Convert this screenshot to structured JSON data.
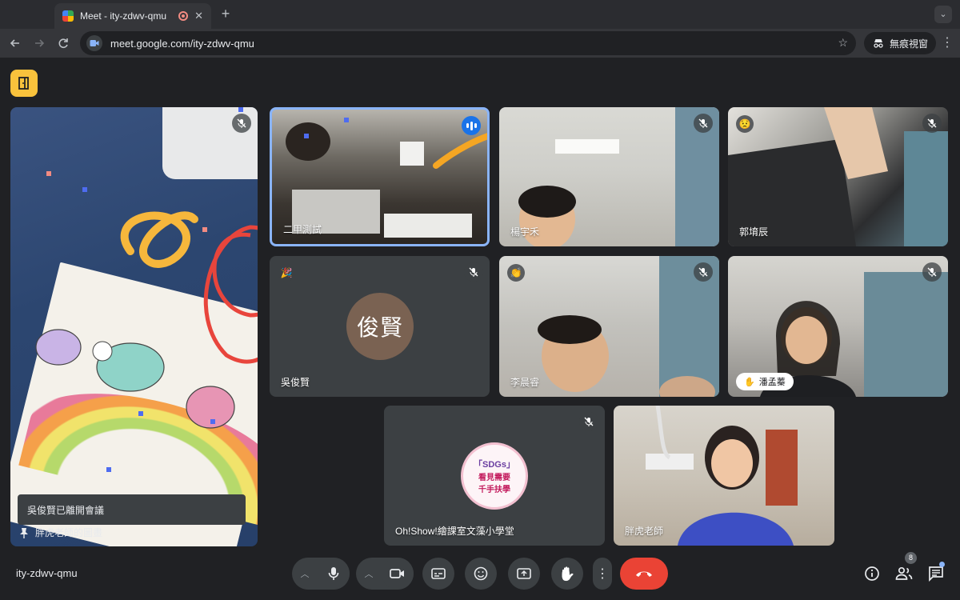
{
  "browser": {
    "tab_title": "Meet - ity-zdwv-qmu",
    "tab_close": "✕",
    "new_tab": "+",
    "tab_menu": "⌄",
    "url": "meet.google.com/ity-zdwv-qmu",
    "incognito_label": "無痕視窗"
  },
  "stage": {
    "tiles": {
      "drawing": {
        "name": "胖虎老師的圖畫",
        "toast": "吳俊賢已離開會議"
      },
      "erjia": {
        "name": "二甲測試"
      },
      "yang": {
        "name": "楊宇禾"
      },
      "guo": {
        "name": "郭堉辰"
      },
      "wu": {
        "name": "吳俊賢",
        "avatar_text": "俊賢"
      },
      "li": {
        "name": "李晨睿"
      },
      "pan": {
        "name": "潘孟蓁"
      },
      "show": {
        "name": "Oh!Show!繪課室文藻小學堂",
        "logo_line1": "「SDGs」",
        "logo_line2": "看見需要",
        "logo_line3": "千手扶學"
      },
      "pang": {
        "name": "胖虎老師"
      }
    }
  },
  "bottom_bar": {
    "meeting_code": "ity-zdwv-qmu",
    "participants_count": "8"
  },
  "colors": {
    "accent_blue": "#8ab4f8",
    "hangup_red": "#ea4335",
    "activities_yellow": "#f9c23c",
    "surface": "#3c4043",
    "background": "#202124"
  }
}
